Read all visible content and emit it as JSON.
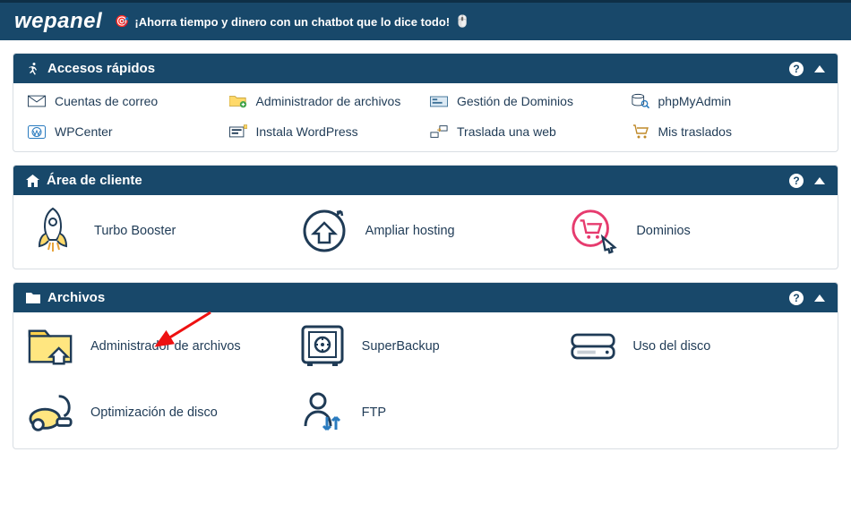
{
  "brand": "wepanel",
  "promo_text": "¡Ahorra tiempo y dinero con un chatbot que lo dice todo!",
  "panels": {
    "quick": {
      "title": "Accesos rápidos",
      "items": [
        {
          "label": "Cuentas de correo"
        },
        {
          "label": "Administrador de archivos"
        },
        {
          "label": "Gestión de Dominios"
        },
        {
          "label": "phpMyAdmin"
        },
        {
          "label": "WPCenter"
        },
        {
          "label": "Instala WordPress"
        },
        {
          "label": "Traslada una web"
        },
        {
          "label": "Mis traslados"
        }
      ]
    },
    "client": {
      "title": "Área de cliente",
      "items": [
        {
          "label": "Turbo Booster"
        },
        {
          "label": "Ampliar hosting"
        },
        {
          "label": "Dominios"
        }
      ]
    },
    "files": {
      "title": "Archivos",
      "items": [
        {
          "label": "Administrador de archivos"
        },
        {
          "label": "SuperBackup"
        },
        {
          "label": "Uso del disco"
        },
        {
          "label": "Optimización de disco"
        },
        {
          "label": "FTP"
        }
      ]
    }
  }
}
